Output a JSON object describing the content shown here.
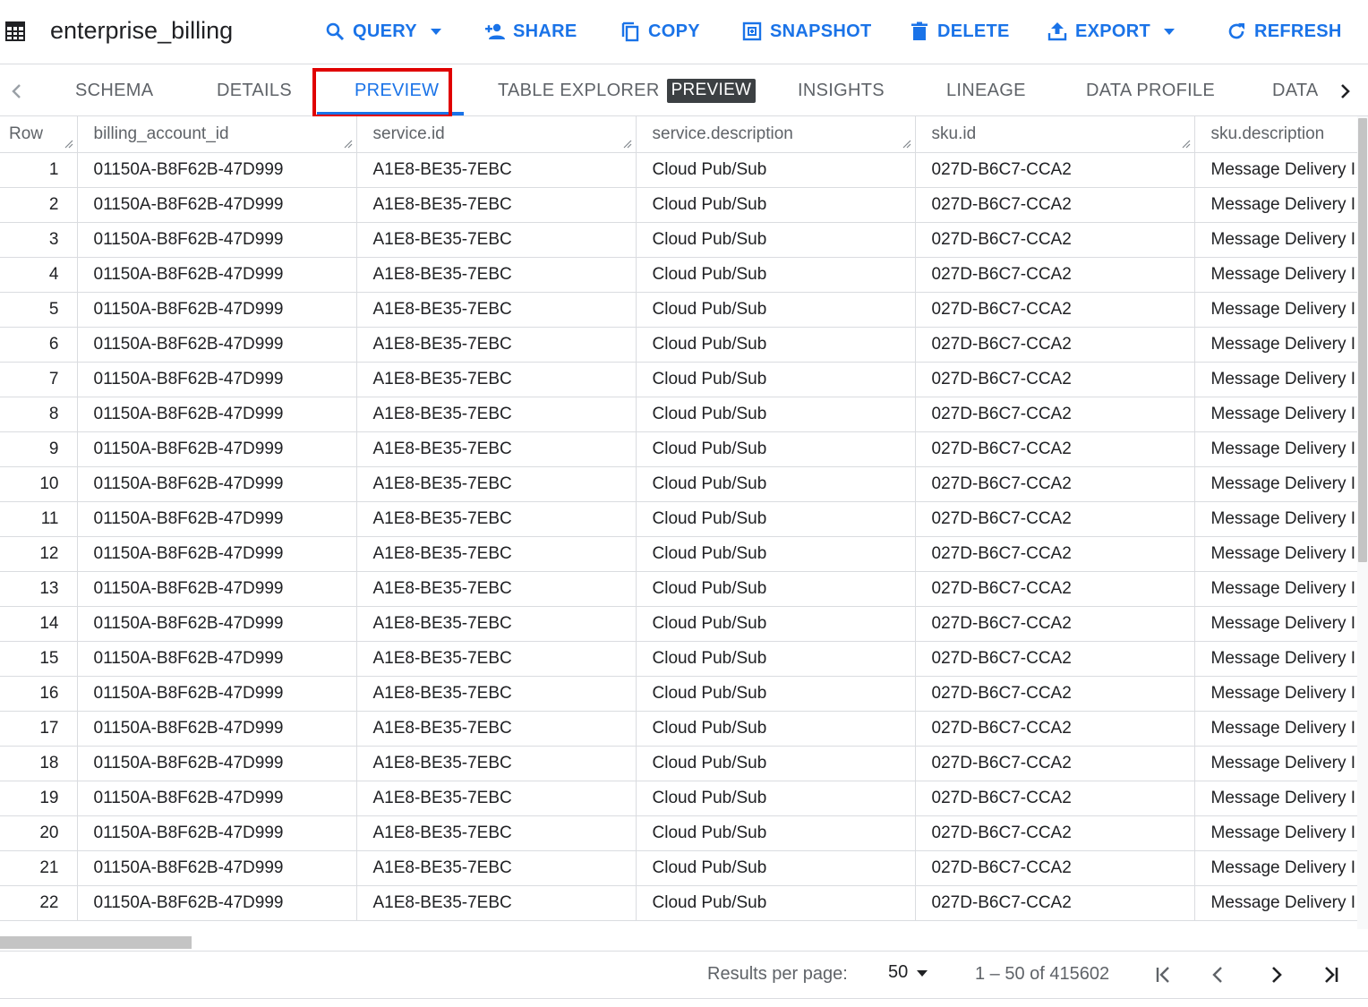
{
  "toolbar": {
    "title": "enterprise_billing",
    "buttons": {
      "query": "QUERY",
      "share": "SHARE",
      "copy": "COPY",
      "snapshot": "SNAPSHOT",
      "delete": "DELETE",
      "export": "EXPORT",
      "refresh": "REFRESH"
    },
    "accent_color": "#1a73e8"
  },
  "tabs": {
    "schema": "SCHEMA",
    "details": "DETAILS",
    "preview": "PREVIEW",
    "table_explorer": "TABLE EXPLORER",
    "table_explorer_badge": "PREVIEW",
    "insights": "INSIGHTS",
    "lineage": "LINEAGE",
    "data_profile": "DATA PROFILE",
    "data_cut": "DATA",
    "active": "PREVIEW",
    "highlight_color": "#e00000"
  },
  "grid": {
    "columns": [
      "Row",
      "billing_account_id",
      "service.id",
      "service.description",
      "sku.id",
      "sku.description"
    ],
    "rows": [
      [
        "1",
        "01150A-B8F62B-47D999",
        "A1E8-BE35-7EBC",
        "Cloud Pub/Sub",
        "027D-B6C7-CCA2",
        "Message Delivery I"
      ],
      [
        "2",
        "01150A-B8F62B-47D999",
        "A1E8-BE35-7EBC",
        "Cloud Pub/Sub",
        "027D-B6C7-CCA2",
        "Message Delivery I"
      ],
      [
        "3",
        "01150A-B8F62B-47D999",
        "A1E8-BE35-7EBC",
        "Cloud Pub/Sub",
        "027D-B6C7-CCA2",
        "Message Delivery I"
      ],
      [
        "4",
        "01150A-B8F62B-47D999",
        "A1E8-BE35-7EBC",
        "Cloud Pub/Sub",
        "027D-B6C7-CCA2",
        "Message Delivery I"
      ],
      [
        "5",
        "01150A-B8F62B-47D999",
        "A1E8-BE35-7EBC",
        "Cloud Pub/Sub",
        "027D-B6C7-CCA2",
        "Message Delivery I"
      ],
      [
        "6",
        "01150A-B8F62B-47D999",
        "A1E8-BE35-7EBC",
        "Cloud Pub/Sub",
        "027D-B6C7-CCA2",
        "Message Delivery I"
      ],
      [
        "7",
        "01150A-B8F62B-47D999",
        "A1E8-BE35-7EBC",
        "Cloud Pub/Sub",
        "027D-B6C7-CCA2",
        "Message Delivery I"
      ],
      [
        "8",
        "01150A-B8F62B-47D999",
        "A1E8-BE35-7EBC",
        "Cloud Pub/Sub",
        "027D-B6C7-CCA2",
        "Message Delivery I"
      ],
      [
        "9",
        "01150A-B8F62B-47D999",
        "A1E8-BE35-7EBC",
        "Cloud Pub/Sub",
        "027D-B6C7-CCA2",
        "Message Delivery I"
      ],
      [
        "10",
        "01150A-B8F62B-47D999",
        "A1E8-BE35-7EBC",
        "Cloud Pub/Sub",
        "027D-B6C7-CCA2",
        "Message Delivery I"
      ],
      [
        "11",
        "01150A-B8F62B-47D999",
        "A1E8-BE35-7EBC",
        "Cloud Pub/Sub",
        "027D-B6C7-CCA2",
        "Message Delivery I"
      ],
      [
        "12",
        "01150A-B8F62B-47D999",
        "A1E8-BE35-7EBC",
        "Cloud Pub/Sub",
        "027D-B6C7-CCA2",
        "Message Delivery I"
      ],
      [
        "13",
        "01150A-B8F62B-47D999",
        "A1E8-BE35-7EBC",
        "Cloud Pub/Sub",
        "027D-B6C7-CCA2",
        "Message Delivery I"
      ],
      [
        "14",
        "01150A-B8F62B-47D999",
        "A1E8-BE35-7EBC",
        "Cloud Pub/Sub",
        "027D-B6C7-CCA2",
        "Message Delivery I"
      ],
      [
        "15",
        "01150A-B8F62B-47D999",
        "A1E8-BE35-7EBC",
        "Cloud Pub/Sub",
        "027D-B6C7-CCA2",
        "Message Delivery I"
      ],
      [
        "16",
        "01150A-B8F62B-47D999",
        "A1E8-BE35-7EBC",
        "Cloud Pub/Sub",
        "027D-B6C7-CCA2",
        "Message Delivery I"
      ],
      [
        "17",
        "01150A-B8F62B-47D999",
        "A1E8-BE35-7EBC",
        "Cloud Pub/Sub",
        "027D-B6C7-CCA2",
        "Message Delivery I"
      ],
      [
        "18",
        "01150A-B8F62B-47D999",
        "A1E8-BE35-7EBC",
        "Cloud Pub/Sub",
        "027D-B6C7-CCA2",
        "Message Delivery I"
      ],
      [
        "19",
        "01150A-B8F62B-47D999",
        "A1E8-BE35-7EBC",
        "Cloud Pub/Sub",
        "027D-B6C7-CCA2",
        "Message Delivery I"
      ],
      [
        "20",
        "01150A-B8F62B-47D999",
        "A1E8-BE35-7EBC",
        "Cloud Pub/Sub",
        "027D-B6C7-CCA2",
        "Message Delivery I"
      ],
      [
        "21",
        "01150A-B8F62B-47D999",
        "A1E8-BE35-7EBC",
        "Cloud Pub/Sub",
        "027D-B6C7-CCA2",
        "Message Delivery I"
      ],
      [
        "22",
        "01150A-B8F62B-47D999",
        "A1E8-BE35-7EBC",
        "Cloud Pub/Sub",
        "027D-B6C7-CCA2",
        "Message Delivery I"
      ]
    ]
  },
  "footer": {
    "results_per_page_label": "Results per page:",
    "results_per_page_value": "50",
    "range_text": "1 – 50 of 415602"
  },
  "icons": {
    "table": "table-icon",
    "query": "search-icon",
    "share": "person-add-icon",
    "copy": "copy-icon",
    "snapshot": "snapshot-icon",
    "delete": "trash-icon",
    "export": "upload-icon",
    "refresh": "refresh-icon",
    "dropdown": "caret-down-icon",
    "tabs_prev": "chevron-left-icon",
    "tabs_next": "chevron-right-icon",
    "first_page": "first-page-icon",
    "prev_page": "chevron-left-icon",
    "next_page": "chevron-right-icon",
    "last_page": "last-page-icon"
  }
}
